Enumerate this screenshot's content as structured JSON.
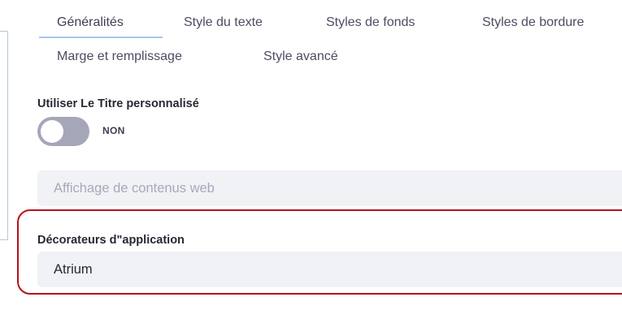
{
  "tabs": [
    {
      "label": "Généralités",
      "active": true
    },
    {
      "label": "Style du texte"
    },
    {
      "label": "Styles de fonds"
    },
    {
      "label": "Styles de bordure"
    },
    {
      "label": "Marge et remplissage"
    },
    {
      "label": "Style avancé"
    }
  ],
  "custom_title": {
    "label": "Utiliser Le Titre personnalisé",
    "toggle_state": "NON"
  },
  "portlet_title": {
    "value": "Affichage de contenus web"
  },
  "decorator": {
    "label": "Décorateurs d\"application",
    "value": "Atrium",
    "highlight_color": "#b5121b"
  }
}
